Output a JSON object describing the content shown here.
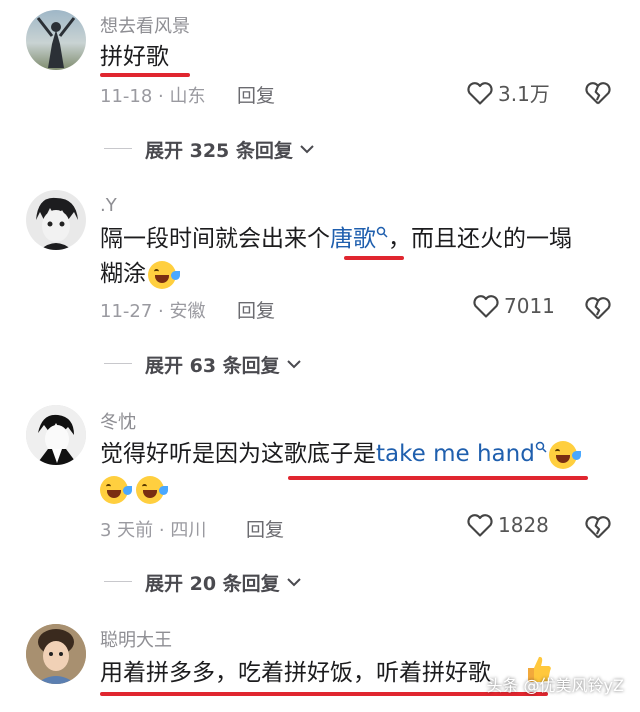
{
  "comments": [
    {
      "username": "想去看风景",
      "text": "拼好歌",
      "meta": "11-18 · 山东",
      "reply_label": "回复",
      "likes": "3.1万",
      "expand_label": "展开 325 条回复"
    },
    {
      "username": ".Y",
      "text_before": "隔一段时间就会出来个",
      "text_link": "唐歌",
      "text_after": "，而且还火的一塌",
      "text_line2": "糊涂",
      "meta": "11-27 · 安徽",
      "reply_label": "回复",
      "likes": "7011",
      "expand_label": "展开 63 条回复"
    },
    {
      "username": "冬忱",
      "text_before": "觉得好听是因为这歌底子是",
      "text_link": "take me hand",
      "meta": "3 天前 · 四川",
      "reply_label": "回复",
      "likes": "1828",
      "expand_label": "展开 20 条回复"
    },
    {
      "username": "聪明大王",
      "text": "用着拼多多，吃着拼好饭，听着拼好歌"
    }
  ],
  "watermark": "头条 @优美风铃yZ",
  "colors": {
    "accent_red": "#e0262f",
    "link_blue": "#1f5fae"
  },
  "icons": [
    "heart-icon",
    "broken-heart-icon",
    "chevron-down-icon",
    "search-icon",
    "laughing-emoji",
    "thumbs-up-emoji"
  ]
}
